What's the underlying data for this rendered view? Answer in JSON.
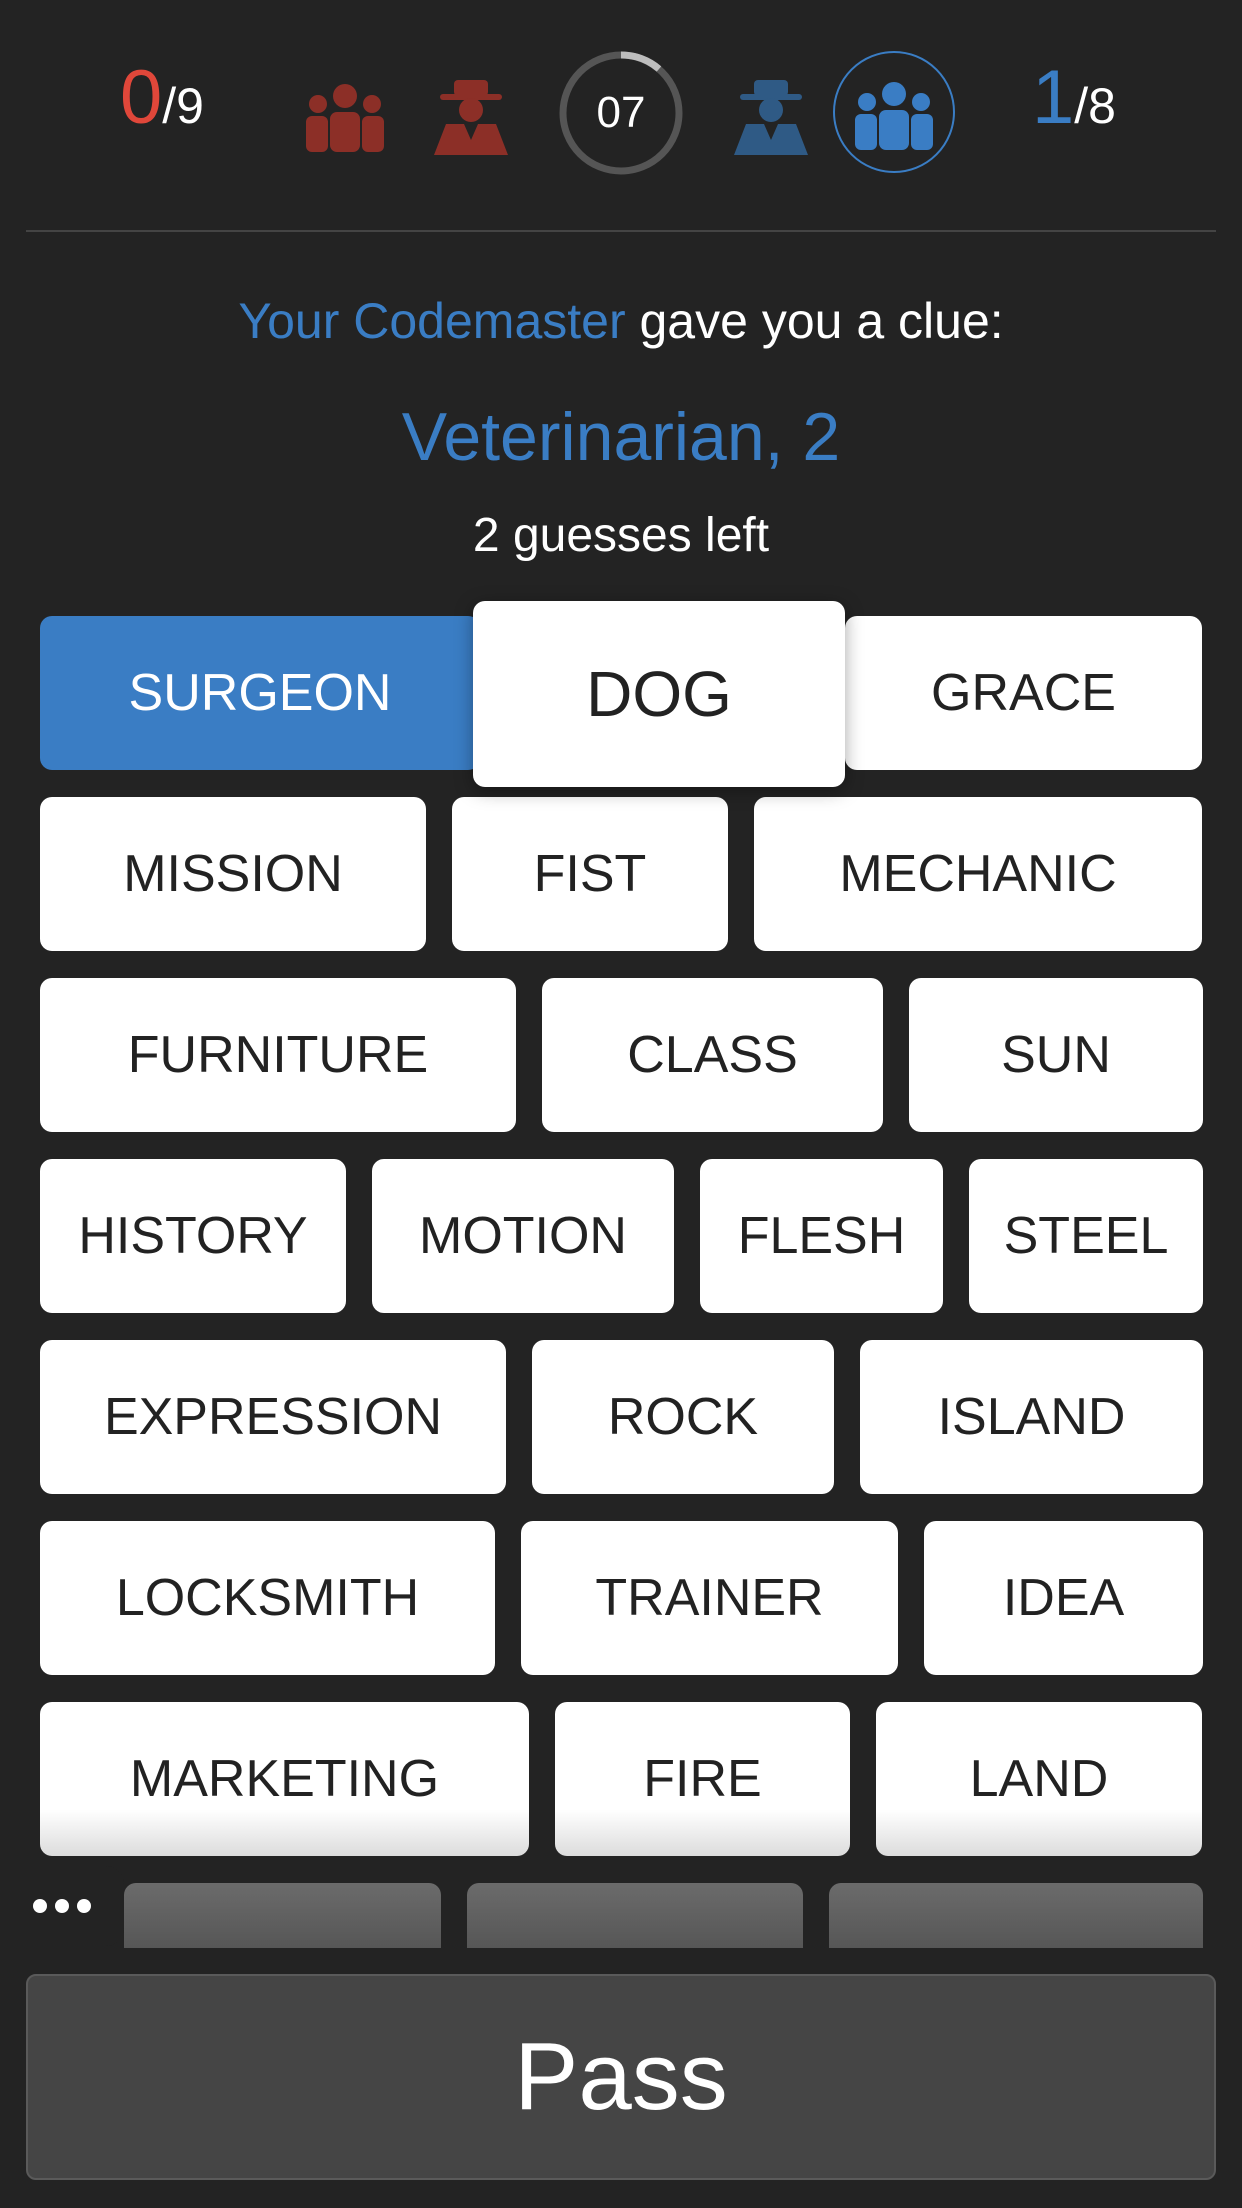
{
  "header": {
    "red_score": "0",
    "red_total": "/9",
    "timer": "07",
    "blue_score": "1",
    "blue_total": "/8",
    "timer_progress": 0.12,
    "colors": {
      "red": "#e0473a",
      "blue": "#3a7dc4",
      "dark_red": "#8c2f27",
      "dark_blue": "#2f5a85"
    }
  },
  "clue": {
    "intro_highlight": "Your Codemaster",
    "intro_rest": " gave you a clue:",
    "word": "Veterinarian, 2",
    "guesses_left": "2 guesses left"
  },
  "board": {
    "row1": [
      "SURGEON",
      "DOG",
      "GRACE"
    ],
    "row2": [
      "MISSION",
      "FIST",
      "MECHANIC"
    ],
    "row3": [
      "FURNITURE",
      "CLASS",
      "SUN"
    ],
    "row4": [
      "HISTORY",
      "MOTION",
      "FLESH",
      "STEEL"
    ],
    "row5": [
      "EXPRESSION",
      "ROCK",
      "ISLAND"
    ],
    "row6": [
      "LOCKSMITH",
      "TRAINER",
      "IDEA"
    ],
    "row7": [
      "MARKETING",
      "FIRE",
      "LAND"
    ]
  },
  "pass_label": "Pass",
  "icons": {
    "red_team": "team-icon",
    "red_spy": "spy-icon",
    "blue_spy": "spy-icon",
    "blue_team": "team-icon",
    "more": "more-icon"
  }
}
